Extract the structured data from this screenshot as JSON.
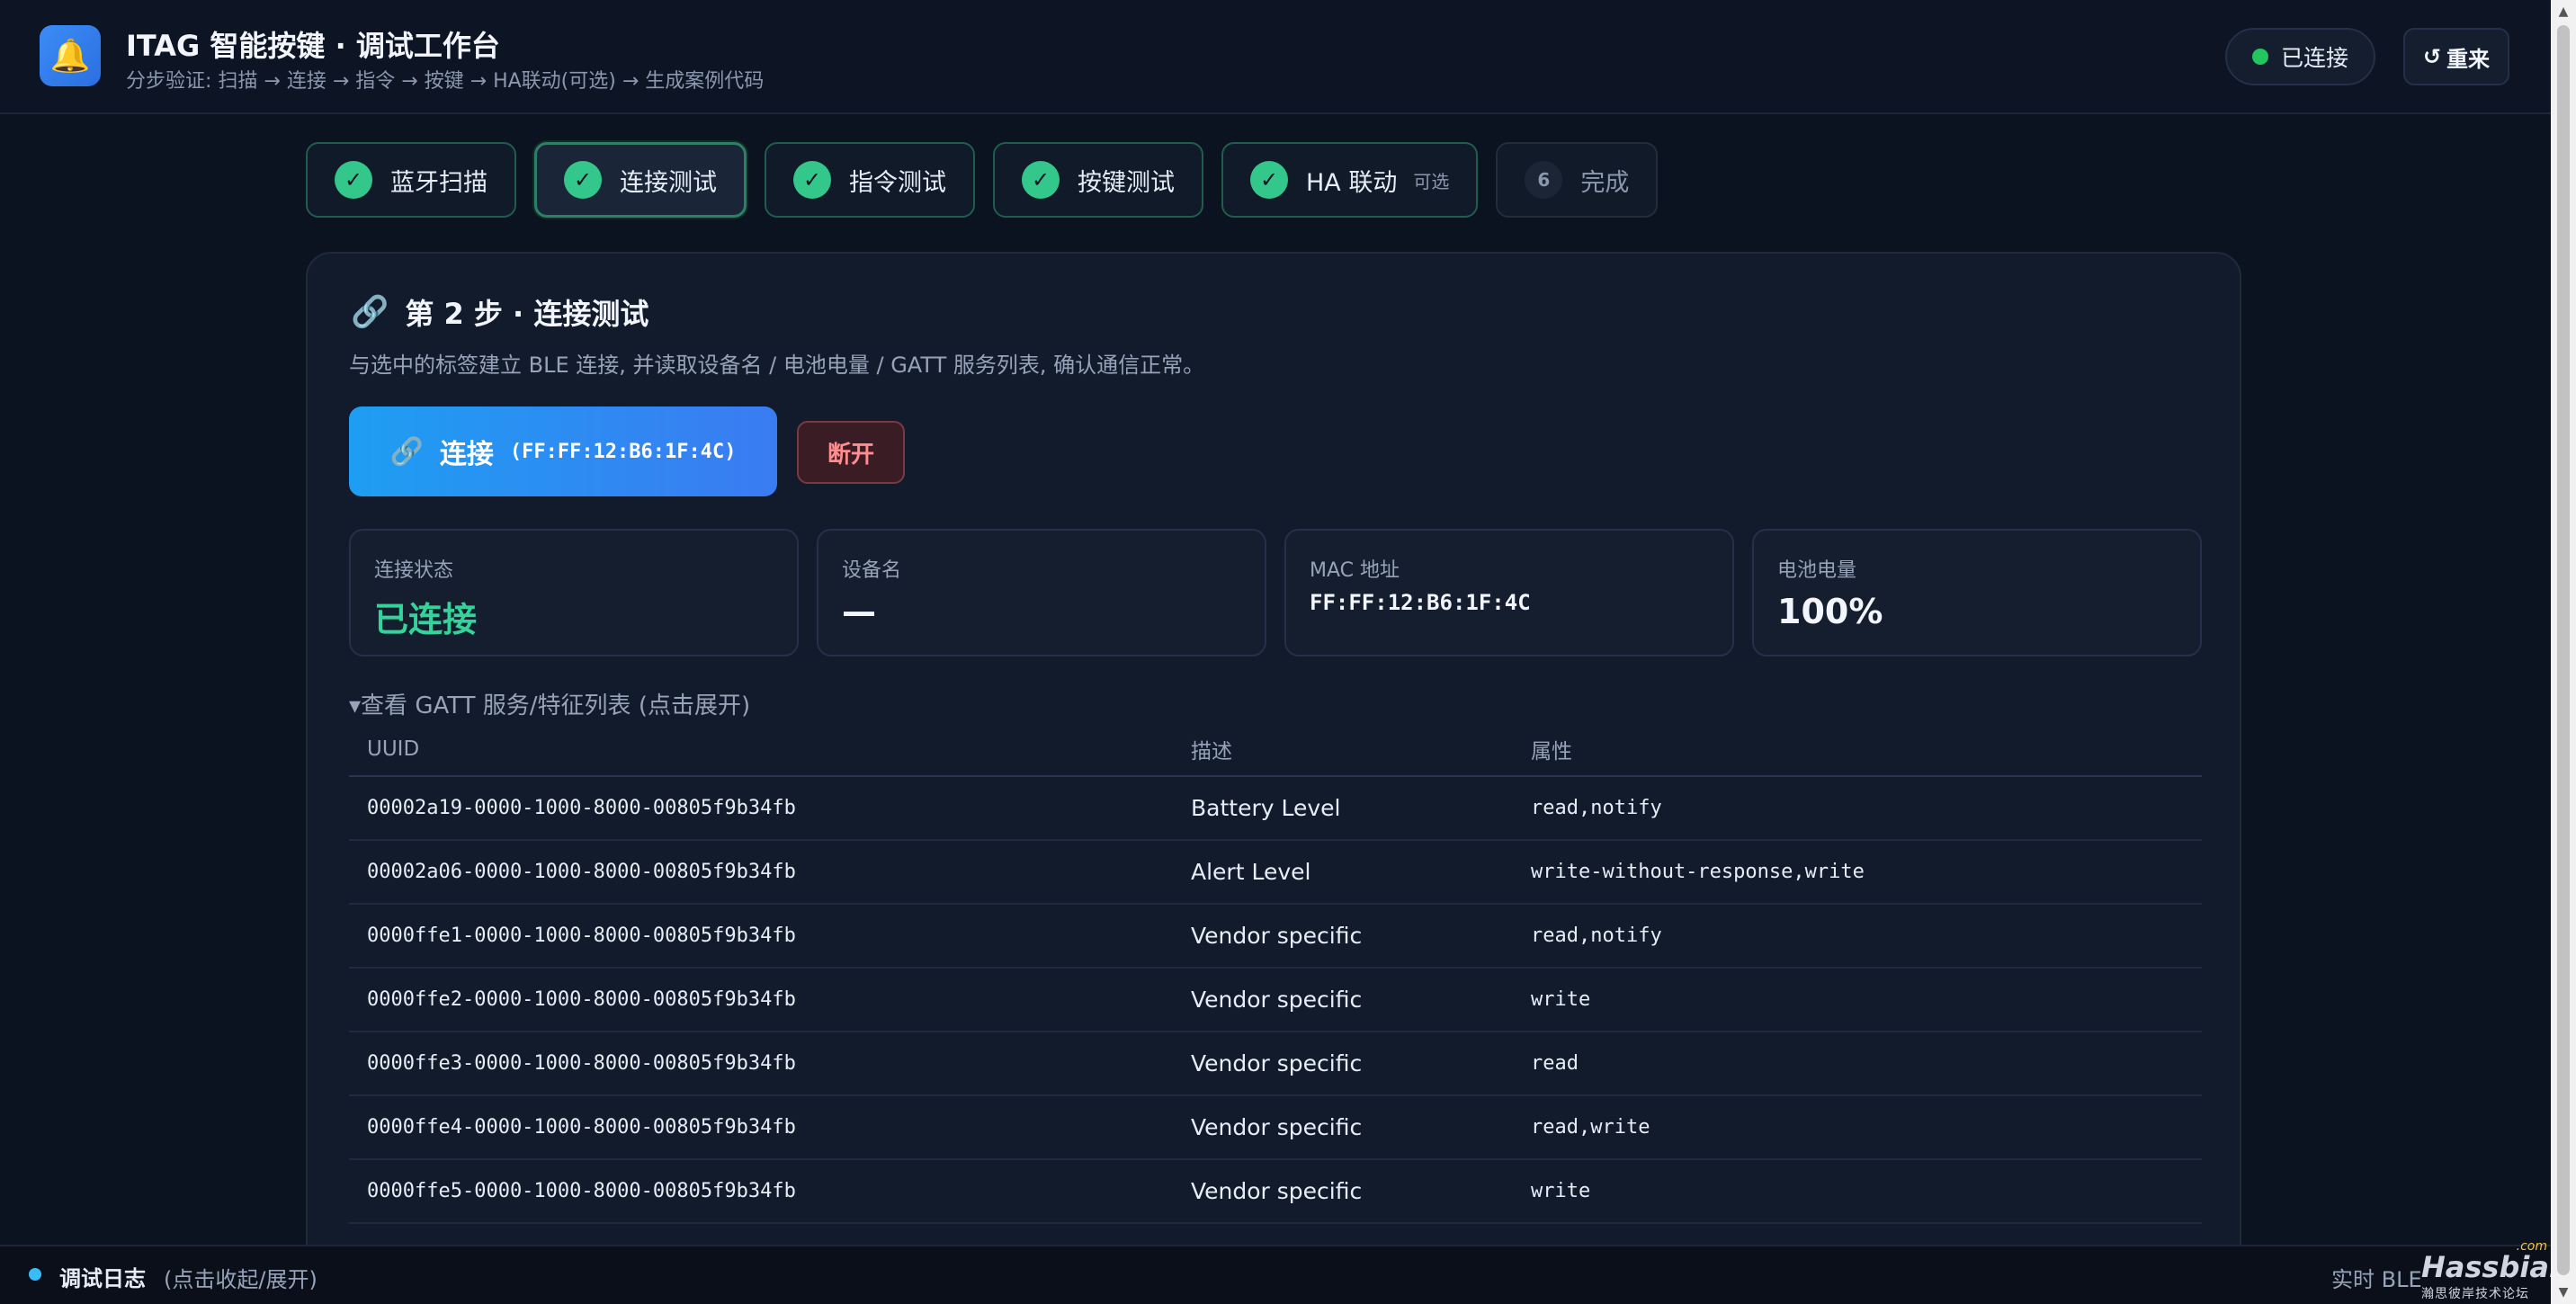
{
  "header": {
    "logo_icon": "bell-icon",
    "title": "ITAG 智能按键 · 调试工作台",
    "subtitle": "分步验证: 扫描 → 连接 → 指令 → 按键 → HA联动(可选) → 生成案例代码",
    "status_label": "已连接",
    "status_color": "#22c55e",
    "reset_icon": "↺",
    "reset_label": "重来"
  },
  "steps": [
    {
      "label": "蓝牙扫描",
      "state": "done"
    },
    {
      "label": "连接测试",
      "state": "active"
    },
    {
      "label": "指令测试",
      "state": "done"
    },
    {
      "label": "按键测试",
      "state": "done"
    },
    {
      "label": "HA 联动",
      "tag": "可选",
      "state": "done"
    },
    {
      "label": "完成",
      "number": "6",
      "state": "pending"
    }
  ],
  "card": {
    "icon": "🔗",
    "title": "第 2 步 · 连接测试",
    "description": "与选中的标签建立 BLE 连接, 并读取设备名 / 电池电量 / GATT 服务列表, 确认通信正常。",
    "connect_label": "连接",
    "connect_mac": "(FF:FF:12:B6:1F:4C)",
    "disconnect_label": "断开",
    "stats": [
      {
        "label": "连接状态",
        "value": "已连接"
      },
      {
        "label": "设备名",
        "value": "—"
      },
      {
        "label": "MAC 地址",
        "value": "FF:FF:12:B6:1F:4C"
      },
      {
        "label": "电池电量",
        "value": "100%"
      }
    ],
    "gatt_summary": "▾查看 GATT 服务/特征列表 (点击展开)",
    "gatt_columns": [
      "UUID",
      "描述",
      "属性"
    ],
    "gatt_rows": [
      {
        "uuid": "00002a19-0000-1000-8000-00805f9b34fb",
        "desc": "Battery Level",
        "props": "read,notify"
      },
      {
        "uuid": "00002a06-0000-1000-8000-00805f9b34fb",
        "desc": "Alert Level",
        "props": "write-without-response,write"
      },
      {
        "uuid": "0000ffe1-0000-1000-8000-00805f9b34fb",
        "desc": "Vendor specific",
        "props": "read,notify"
      },
      {
        "uuid": "0000ffe2-0000-1000-8000-00805f9b34fb",
        "desc": "Vendor specific",
        "props": "write"
      },
      {
        "uuid": "0000ffe3-0000-1000-8000-00805f9b34fb",
        "desc": "Vendor specific",
        "props": "read"
      },
      {
        "uuid": "0000ffe4-0000-1000-8000-00805f9b34fb",
        "desc": "Vendor specific",
        "props": "read,write"
      },
      {
        "uuid": "0000ffe5-0000-1000-8000-00805f9b34fb",
        "desc": "Vendor specific",
        "props": "write"
      }
    ]
  },
  "logbar": {
    "title": "调试日志",
    "hint": "(点击收起/展开)",
    "right_text": "实时 BLE"
  },
  "watermark": {
    "brand": "Hassbian",
    "com": ".com",
    "sub": "瀚思彼岸技术论坛"
  }
}
